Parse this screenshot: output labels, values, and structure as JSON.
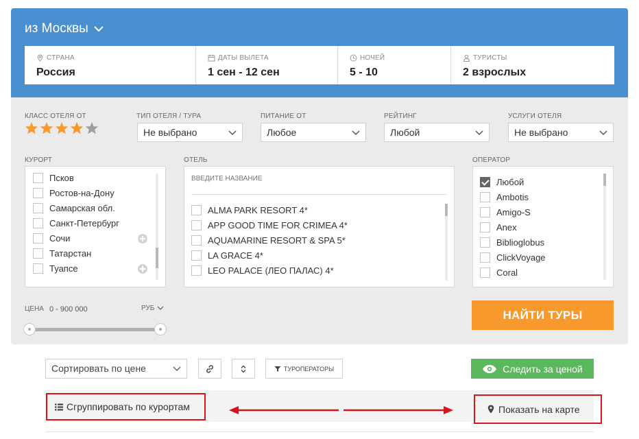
{
  "header": {
    "from_label": "из Москвы",
    "fields": [
      {
        "label": "СТРАНА",
        "value": "Россия",
        "icon": "pin-icon"
      },
      {
        "label": "ДАТЫ ВЫЛЕТА",
        "value": "1 сен - 12 сен",
        "icon": "calendar-icon"
      },
      {
        "label": "НОЧЕЙ",
        "value": "5 - 10",
        "icon": "clock-icon"
      },
      {
        "label": "ТУРИСТЫ",
        "value": "2 взрослых",
        "icon": "person-icon"
      }
    ]
  },
  "filters": {
    "hotel_class": {
      "label": "КЛАСС ОТЕЛЯ ОТ",
      "stars_filled": 4,
      "stars_total": 5
    },
    "hotel_type": {
      "label": "ТИП ОТЕЛЯ / ТУРА",
      "value": "Не выбрано"
    },
    "meal": {
      "label": "ПИТАНИЕ ОТ",
      "value": "Любое"
    },
    "rating": {
      "label": "РЕЙТИНГ",
      "value": "Любой"
    },
    "services": {
      "label": "УСЛУГИ ОТЕЛЯ",
      "value": "Не выбрано"
    },
    "resort": {
      "label": "КУРОРТ",
      "items": [
        {
          "name": "Псков",
          "expandable": false
        },
        {
          "name": "Ростов-на-Дону",
          "expandable": false
        },
        {
          "name": "Самарская обл.",
          "expandable": false
        },
        {
          "name": "Санкт-Петербург",
          "expandable": false
        },
        {
          "name": "Сочи",
          "expandable": true
        },
        {
          "name": "Татарстан",
          "expandable": false
        },
        {
          "name": "Туапсе",
          "expandable": true
        }
      ]
    },
    "hotel": {
      "label": "ОТЕЛЬ",
      "placeholder": "ВВЕДИТЕ НАЗВАНИЕ",
      "items": [
        "ALMA PARK RESORT 4*",
        "APP GOOD TIME FOR CRIMEA 4*",
        "AQUAMARINE RESORT & SPA 5*",
        "LA GRACE 4*",
        "LEO PALACE (ЛЕО ПАЛАС) 4*"
      ]
    },
    "operator": {
      "label": "ОПЕРАТОР",
      "items": [
        {
          "name": "Любой",
          "checked": true
        },
        {
          "name": "Ambotis",
          "checked": false
        },
        {
          "name": "Amigo-S",
          "checked": false
        },
        {
          "name": "Anex",
          "checked": false
        },
        {
          "name": "Biblioglobus",
          "checked": false
        },
        {
          "name": "ClickVoyage",
          "checked": false
        },
        {
          "name": "Coral",
          "checked": false
        }
      ]
    },
    "price": {
      "label": "ЦЕНА",
      "range_text": "0 -  900 000",
      "currency": "РУБ"
    },
    "search_button": "НАЙТИ ТУРЫ"
  },
  "toolbar": {
    "sort_value": "Сортировать по цене",
    "operators_button": "ТУРОПЕРАТОРЫ",
    "watch_price_button": "Следить за ценой",
    "group_button": "Сгруппировать по курортам",
    "map_button": "Показать на карте"
  },
  "colors": {
    "header_blue": "#4a8fcf",
    "search_orange": "#f7992d",
    "watch_green": "#5cb85c",
    "highlight_red": "#d9151b",
    "star_active": "#f7992d",
    "star_inactive": "#9e9e9e"
  }
}
